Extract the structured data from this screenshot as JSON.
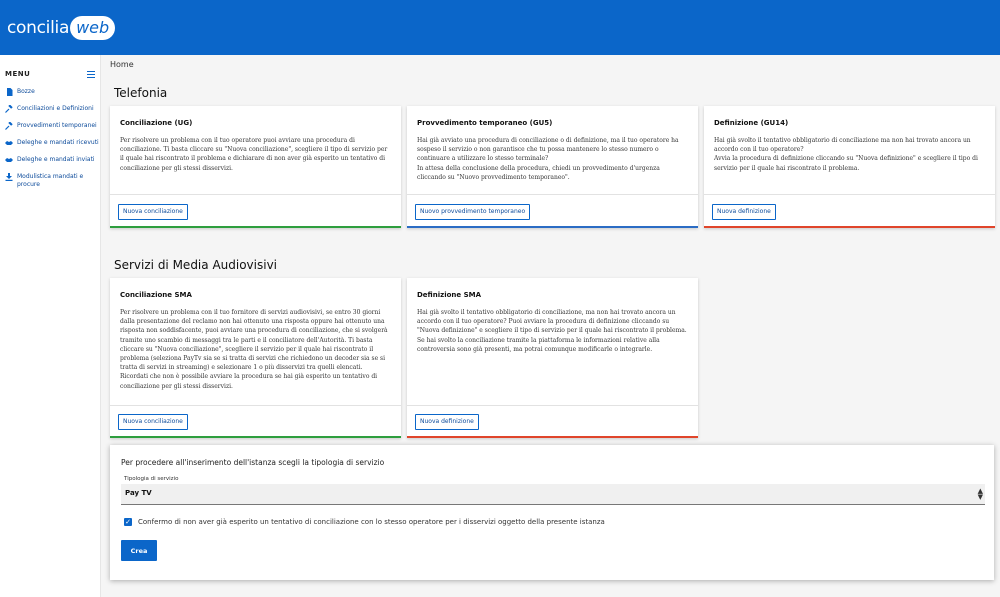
{
  "header": {
    "logo_part1": "concilia",
    "logo_part2": "web"
  },
  "sidebar": {
    "menu_title": "MENU",
    "items": [
      {
        "label": "Bozze",
        "icon": "document-icon"
      },
      {
        "label": "Conciliazioni e Definizioni",
        "icon": "gavel-icon"
      },
      {
        "label": "Provvedimenti temporanei",
        "icon": "gavel-icon"
      },
      {
        "label": "Deleghe e mandati ricevuti",
        "icon": "handshake-icon"
      },
      {
        "label": "Deleghe e mandati inviati",
        "icon": "handshake-icon"
      },
      {
        "label": "Modulistica mandati e procure",
        "icon": "download-icon"
      }
    ]
  },
  "breadcrumb": "Home",
  "sections": {
    "telefonia": {
      "title": "Telefonia",
      "cards": [
        {
          "title": "Conciliazione (UG)",
          "text": "Per risolvere un problema con il tuo operatore puoi avviare una procedura di conciliazione. Ti basta cliccare su \"Nuova conciliazione\", scegliere il tipo di servizio per il quale hai riscontrato il problema e dichiarare di non aver già esperito un tentativo di conciliazione per gli stessi disservizi.",
          "button": "Nuova conciliazione",
          "bar_color": "#2e9e3e"
        },
        {
          "title": "Provvedimento temporaneo (GU5)",
          "text": "Hai già avviato una procedura di conciliazione o di definizione, ma il tuo operatore ha sospeso il servizio o non garantisce che tu possa mantenere lo stesso numero o continuare a utilizzare lo stesso terminale?\nIn attesa della conclusione della procedura, chiedi un provvedimento d'urgenza cliccando su \"Nuovo provvedimento temporaneo\".",
          "button": "Nuovo provvedimento temporaneo",
          "bar_color": "#2b6cc4"
        },
        {
          "title": "Definizione (GU14)",
          "text": "Hai già svolto il tentativo obbligatorio di conciliazione ma non hai trovato ancora un accordo con il tuo operatore?\nAvvia la procedura di definizione cliccando su \"Nuova definizione\" e scegliere il tipo di servizio per il quale hai riscontrato il problema.",
          "button": "Nuova definizione",
          "bar_color": "#e0452b"
        }
      ]
    },
    "sma": {
      "title": "Servizi di Media Audiovisivi",
      "cards": [
        {
          "title": "Conciliazione SMA",
          "text": "Per risolvere un problema con il tuo fornitore di servizi audiovisivi, se entro 30 giorni dalla presentazione del reclamo non hai ottenuto una risposta oppure hai ottenuto una risposta non soddisfacente, puoi avviare una procedura di conciliazione, che si svolgerà tramite uno scambio di messaggi tra le parti e il conciliatore dell'Autorità. Ti basta cliccare su \"Nuova conciliazione\", scegliere il servizio per il quale hai riscontrato il problema (seleziona PayTv sia se si tratta di servizi che richiedono un decoder sia se si tratta di servizi in streaming) e selezionare 1 o più disservizi tra quelli elencati. Ricordati che non è possibile avviare la procedura se hai già esperito un tentativo di conciliazione per gli stessi disservizi.",
          "button": "Nuova conciliazione",
          "bar_color": "#2e9e3e"
        },
        {
          "title": "Definizione SMA",
          "text": "Hai già svolto il tentativo obbligatorio di conciliazione, ma non hai trovato ancora un accordo con il tuo operatore? Puoi avviare la procedura di definizione cliccando su \"Nuova definizione\" e scegliere il tipo di servizio per il quale hai riscontrato il problema. Se hai svolto la conciliazione tramite la piattaforma le informazioni relative alla controversia sono già presenti, ma potrai comunque modificarle o integrarle.",
          "button": "Nuova definizione",
          "bar_color": "#e0452b"
        }
      ]
    }
  },
  "form": {
    "intro": "Per procedere all'inserimento dell'istanza scegli la tipologia di servizio",
    "select_label": "Tipologia di servizio",
    "select_value": "Pay TV",
    "checkbox_label": "Confermo di non aver già esperito un tentativo di conciliazione con lo stesso operatore per i disservizi oggetto della presente istanza",
    "checkbox_checked": true,
    "submit_label": "Crea"
  },
  "colors": {
    "primary": "#0b66c9",
    "green": "#2e9e3e",
    "blue": "#2b6cc4",
    "red": "#e0452b"
  }
}
